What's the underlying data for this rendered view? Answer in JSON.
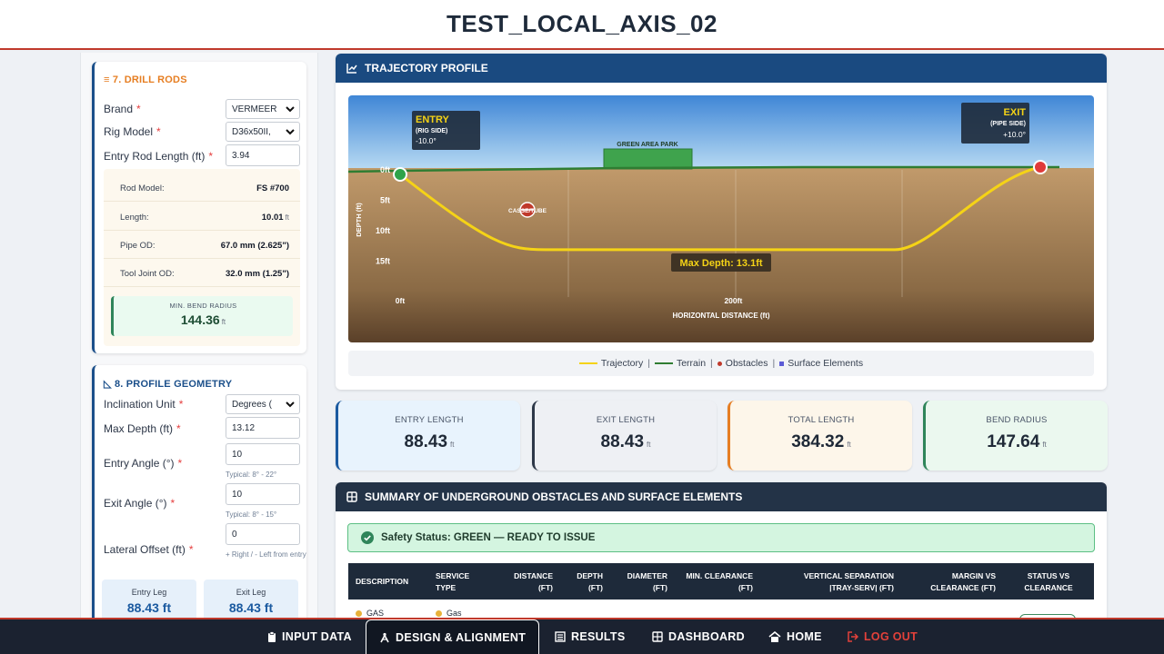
{
  "header": {
    "title": "TEST_LOCAL_AXIS_02"
  },
  "drill_rods": {
    "title": "7. DRILL RODS",
    "brand_label": "Brand",
    "brand_value": "VERMEER",
    "rig_label": "Rig Model",
    "rig_value": "D36x50II,",
    "entry_rod_label": "Entry Rod Length (ft)",
    "entry_rod_value": "3.94",
    "specs": [
      {
        "key": "Rod Model:",
        "value": "FS #700",
        "unit": ""
      },
      {
        "key": "Length:",
        "value": "10.01",
        "unit": "ft"
      },
      {
        "key": "Pipe OD:",
        "value": "67.0 mm (2.625\")",
        "unit": ""
      },
      {
        "key": "Tool Joint OD:",
        "value": "32.0 mm (1.25\")",
        "unit": ""
      }
    ],
    "min_bend_label": "MIN. BEND RADIUS",
    "min_bend_value": "144.36",
    "min_bend_unit": "ft"
  },
  "profile_geometry": {
    "title": "8. PROFILE GEOMETRY",
    "inclination_label": "Inclination Unit",
    "inclination_value": "Degrees (",
    "max_depth_label": "Max Depth (ft)",
    "max_depth_value": "13.12",
    "entry_angle_label": "Entry Angle (°)",
    "entry_angle_value": "10",
    "entry_angle_hint": "Typical: 8° - 22°",
    "exit_angle_label": "Exit Angle (°)",
    "exit_angle_value": "10",
    "exit_angle_hint": "Typical: 8° - 15°",
    "lateral_label": "Lateral Offset (ft)",
    "lateral_value": "0",
    "lateral_hint": "+ Right / - Left from entry",
    "entry_leg_label": "Entry Leg",
    "entry_leg_value": "88.43 ft",
    "exit_leg_label": "Exit Leg",
    "exit_leg_value": "88.43 ft"
  },
  "trajectory": {
    "title": "TRAJECTORY PROFILE",
    "entry_title": "ENTRY",
    "entry_sub": "(RIG SIDE)",
    "entry_angle": "-10.0°",
    "exit_title": "EXIT",
    "exit_sub": "(PIPE SIDE)",
    "exit_angle": "+10.0°",
    "surface_element": "GREEN AREA PARK",
    "obstacle_label": "CASSE/TUBE",
    "max_depth_label": "Max Depth: 13.1ft",
    "legend": {
      "trajectory": "Trajectory",
      "terrain": "Terrain",
      "obstacles": "Obstacles",
      "surface": "Surface Elements"
    }
  },
  "chart_data": {
    "type": "line",
    "xlabel": "HORIZONTAL DISTANCE (ft)",
    "ylabel": "DEPTH (ft)",
    "x_ticks": [
      "0ft",
      "200ft"
    ],
    "y_ticks": [
      "0ft",
      "5ft",
      "10ft",
      "15ft"
    ],
    "xlim": [
      0,
      384.32
    ],
    "ylim": [
      0,
      15
    ],
    "series": [
      {
        "name": "Trajectory",
        "x": [
          0,
          87,
          297,
          384.32
        ],
        "y": [
          0,
          13.12,
          13.12,
          0
        ]
      },
      {
        "name": "Terrain",
        "x": [
          0,
          384.32
        ],
        "y": [
          0,
          0
        ]
      }
    ]
  },
  "stats": {
    "entry_length": {
      "label": "ENTRY LENGTH",
      "value": "88.43",
      "unit": "ft"
    },
    "exit_length": {
      "label": "EXIT LENGTH",
      "value": "88.43",
      "unit": "ft"
    },
    "total_length": {
      "label": "TOTAL LENGTH",
      "value": "384.32",
      "unit": "ft"
    },
    "bend_radius": {
      "label": "BEND RADIUS",
      "value": "147.64",
      "unit": "ft"
    }
  },
  "summary": {
    "title": "SUMMARY OF UNDERGROUND OBSTACLES AND SURFACE ELEMENTS",
    "safety_status": "Safety Status: GREEN — READY TO ISSUE",
    "columns": {
      "description": "DESCRIPTION",
      "service_1": "SERVICE",
      "service_2": "TYPE",
      "distance_1": "DISTANCE",
      "distance_2": "(FT)",
      "depth_1": "DEPTH",
      "depth_2": "(FT)",
      "diameter_1": "DIAMETER",
      "diameter_2": "(FT)",
      "clearance_1": "MIN. CLEARANCE",
      "clearance_2": "(FT)",
      "vertical_1": "VERTICAL SEPARATION",
      "vertical_2": "|TRAY-SERV| (FT)",
      "margin_1": "MARGIN VS",
      "margin_2": "CLEARANCE (FT)",
      "status_1": "STATUS VS",
      "status_2": "CLEARANCE"
    },
    "row": {
      "description": "GAS",
      "service": "Gas"
    }
  },
  "nav": {
    "input_data": "INPUT DATA",
    "design": "DESIGN & ALIGNMENT",
    "results": "RESULTS",
    "dashboard": "DASHBOARD",
    "home": "HOME",
    "logout": "LOG OUT"
  },
  "colors": {
    "primary": "#1a4a80",
    "accent_red": "#c0392b",
    "trajectory": "#f5d316",
    "terrain": "#2f7d32",
    "safe": "#2f855a"
  }
}
